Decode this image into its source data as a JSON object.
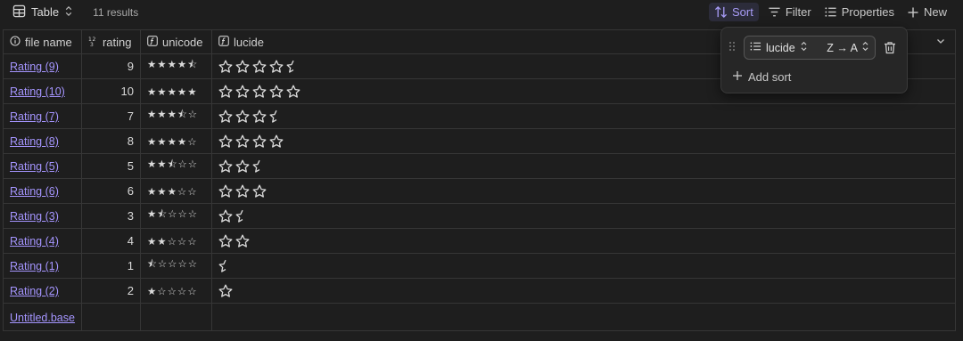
{
  "toolbar": {
    "view_name": "Table",
    "results": "11 results",
    "sort_label": "Sort",
    "filter_label": "Filter",
    "properties_label": "Properties",
    "new_label": "New"
  },
  "columns": {
    "file_name": "file name",
    "rating": "rating",
    "unicode": "unicode",
    "lucide": "lucide"
  },
  "rows": [
    {
      "name": "Rating (9)",
      "rating": "9",
      "unicode": "★★★★⯪",
      "lucide": [
        1,
        1,
        1,
        1,
        0.5
      ]
    },
    {
      "name": "Rating (10)",
      "rating": "10",
      "unicode": "★★★★★",
      "lucide": [
        1,
        1,
        1,
        1,
        1
      ]
    },
    {
      "name": "Rating (7)",
      "rating": "7",
      "unicode": "★★★⯪☆",
      "lucide": [
        1,
        1,
        1,
        0.5
      ]
    },
    {
      "name": "Rating (8)",
      "rating": "8",
      "unicode": "★★★★☆",
      "lucide": [
        1,
        1,
        1,
        1
      ]
    },
    {
      "name": "Rating (5)",
      "rating": "5",
      "unicode": "★★⯪☆☆",
      "lucide": [
        1,
        1,
        0.5
      ]
    },
    {
      "name": "Rating (6)",
      "rating": "6",
      "unicode": "★★★☆☆",
      "lucide": [
        1,
        1,
        1
      ]
    },
    {
      "name": "Rating (3)",
      "rating": "3",
      "unicode": "★⯪☆☆☆",
      "lucide": [
        1,
        0.5
      ]
    },
    {
      "name": "Rating (4)",
      "rating": "4",
      "unicode": "★★☆☆☆",
      "lucide": [
        1,
        1
      ]
    },
    {
      "name": "Rating (1)",
      "rating": "1",
      "unicode": "⯪☆☆☆☆",
      "lucide": [
        0.5
      ]
    },
    {
      "name": "Rating (2)",
      "rating": "2",
      "unicode": "★☆☆☆☆",
      "lucide": [
        1
      ]
    }
  ],
  "footer_file": "Untitled.base",
  "sort_popover": {
    "field": "lucide",
    "direction": "Z → A",
    "add_sort_label": "Add sort"
  },
  "colors": {
    "background": "#1e1e1e",
    "accent": "#a89cf7",
    "link": "#a595ff",
    "border": "#363636"
  },
  "icons": [
    "table-icon",
    "updown-chevron-icon",
    "sort-icon",
    "filter-icon",
    "properties-icon",
    "plus-icon",
    "info-icon",
    "number-icon",
    "formula-icon",
    "star-icon",
    "star-half-icon",
    "grip-icon",
    "list-icon",
    "trash-icon",
    "chevron-down-icon"
  ]
}
